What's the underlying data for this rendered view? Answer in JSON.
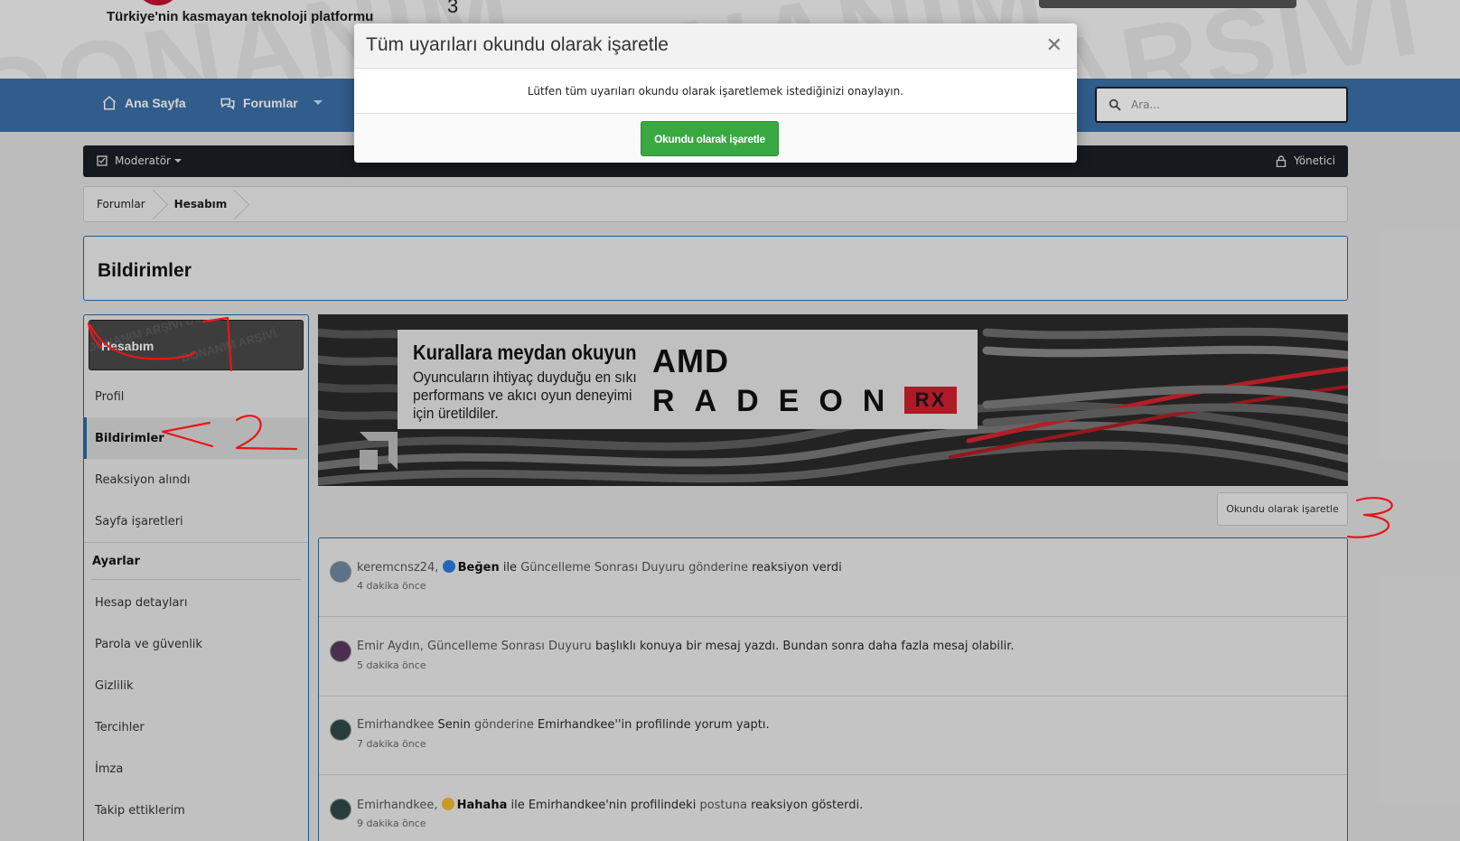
{
  "header": {
    "tagline": "Türkiye'nin kasmayan teknoloji platformu",
    "top_number": "3"
  },
  "nav": {
    "items": [
      {
        "label": "Ana Sayfa",
        "icon": "home-icon"
      },
      {
        "label": "Forumlar",
        "icon": "chat-icon"
      }
    ],
    "search_placeholder": "Ara..."
  },
  "modbar": {
    "left_label": "Moderatör",
    "right_label": "Yönetici"
  },
  "breadcrumb": [
    "Forumlar",
    "Hesabım"
  ],
  "page_title": "Bildirimler",
  "sidebar": {
    "header": "Hesabım",
    "items_top": [
      "Profil",
      "Bildirimler",
      "Reaksiyon alındı",
      "Sayfa işaretleri"
    ],
    "active": "Bildirimler",
    "section_title": "Ayarlar",
    "items_settings": [
      "Hesap detayları",
      "Parola ve güvenlik",
      "Gizlilik",
      "Tercihler",
      "İmza",
      "Takip ettiklerim"
    ]
  },
  "banner": {
    "headline": "Kurallara meydan okuyun",
    "subtext": "Oyuncuların ihtiyaç duyduğu en sıkı performans ve akıcı oyun deneyimi için üretildiler.",
    "brand": "AMD",
    "product": "RADEON",
    "product_suffix": "RX"
  },
  "mark_read_button": "Okundu olarak işaretle",
  "notifications": [
    {
      "user": "keremcnsz24,",
      "reaction": "Beğen",
      "p1": " ile ",
      "link": "Güncelleme Sonrası Duyuru gönderine",
      "p2": " reaksiyon verdi",
      "time": "4 dakika önce"
    },
    {
      "user": "Emir Aydın,",
      "link": "Güncelleme Sonrası Duyuru",
      "p2": " başlıklı konuya bir mesaj yazdı. Bundan sonra daha fazla mesaj olabilir.",
      "time": "5 dakika önce"
    },
    {
      "user": "Emirhandkee",
      "p1": " Senin ",
      "link": "gönderine",
      "p2": " Emirhandkee''in profilinde yorum yaptı.",
      "time": "7 dakika önce"
    },
    {
      "user": "Emirhandkee,",
      "reaction": "Hahaha",
      "p1": " ile Emirhandkee'nin profilindeki ",
      "link": "postuna",
      "p2": " reaksiyon gösterdi.",
      "time": "9 dakika önce"
    }
  ],
  "modal": {
    "title": "Tüm uyarıları okundu olarak işaretle",
    "close_glyph": "✕",
    "message": "Lütfen tüm uyarıları okundu olarak işaretlemek istediğinizi onaylayın.",
    "confirm_label": "Okundu olarak işaretle"
  },
  "colors": {
    "nav_blue": "#3a70a8",
    "confirm_green": "#3aa840",
    "annotation_red": "#e8161b"
  }
}
